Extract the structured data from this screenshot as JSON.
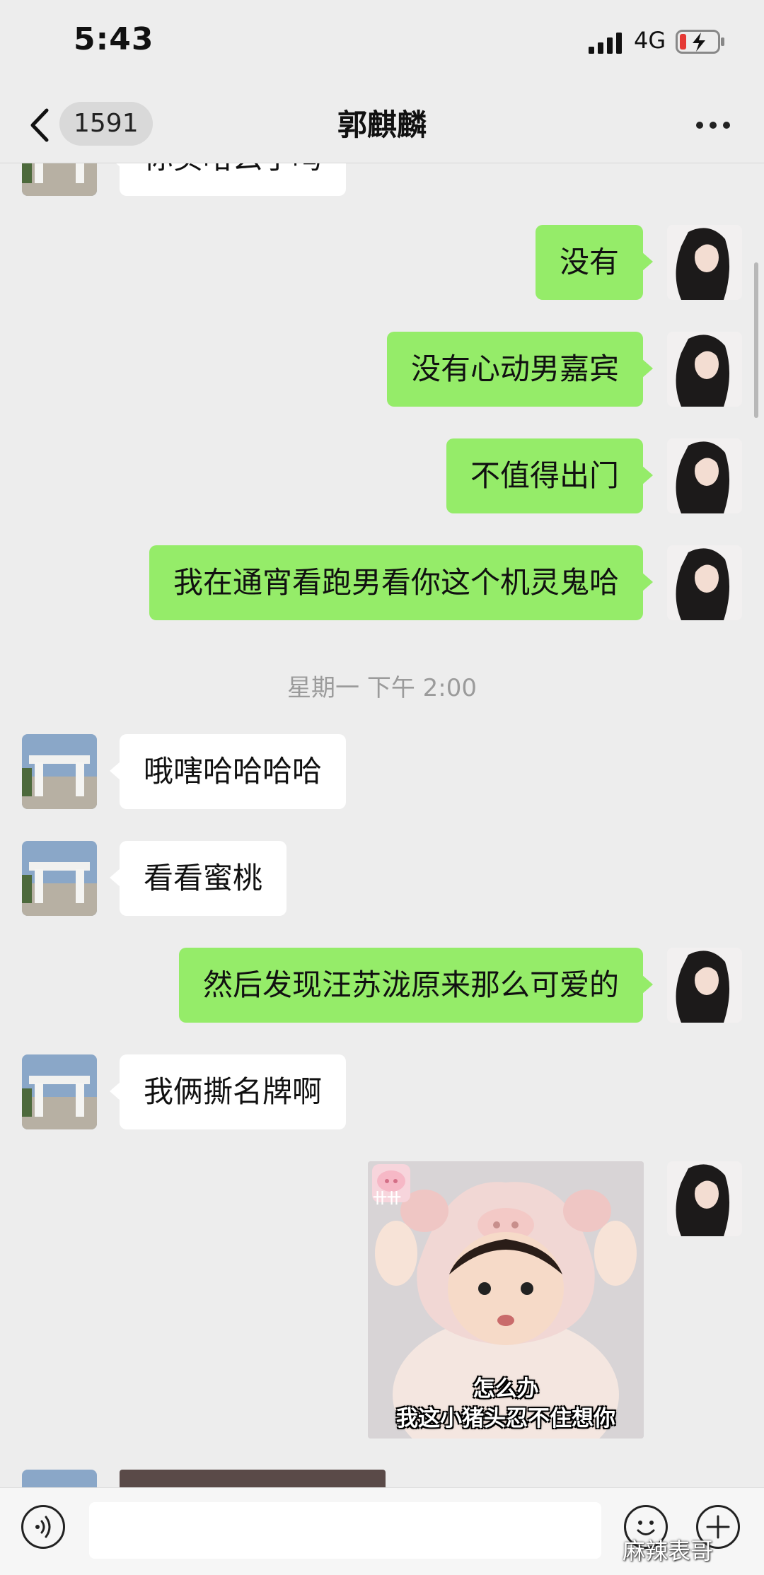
{
  "status_bar": {
    "time": "5:43",
    "network": "4G"
  },
  "nav": {
    "unread_count": "1591",
    "title": "郭麒麟"
  },
  "messages": {
    "partial_top": "你买哈么了吗",
    "m1": "没有",
    "m2": "没有心动男嘉宾",
    "m3": "不值得出门",
    "m4": "我在通宵看跑男看你这个机灵鬼哈",
    "timestamp": "星期一 下午 2:00",
    "m5": "哦嗐哈哈哈哈",
    "m6": "看看蜜桃",
    "m7": "然后发现汪苏泷原来那么可爱的",
    "m8": "我俩撕名牌啊",
    "sticker_badge": "卄卄",
    "sticker_line1": "怎么办",
    "sticker_line2": "我这小猪头忍不住想你"
  },
  "input_bar": {
    "placeholder": "",
    "watermark": "麻辣表哥"
  },
  "colors": {
    "bubble_out": "#95ec69",
    "bubble_in": "#ffffff",
    "background": "#ededed"
  },
  "icons": {
    "back": "chevron-left-icon",
    "more": "ellipsis-icon",
    "voice": "voice-icon",
    "emoji": "smiley-icon",
    "plus": "plus-icon",
    "signal": "signal-icon",
    "battery": "battery-charging-icon"
  }
}
